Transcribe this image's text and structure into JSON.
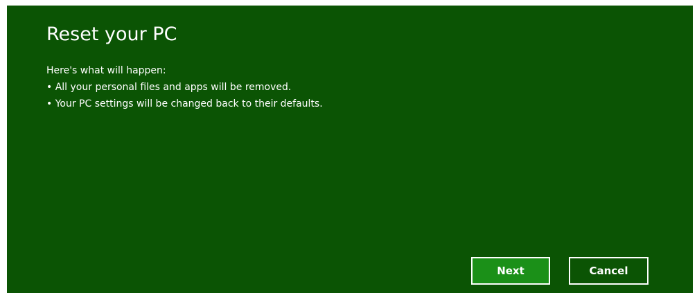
{
  "dialog": {
    "title": "Reset your PC",
    "intro": "Here's what will happen:",
    "bullets": [
      "• All your personal files and apps will be removed.",
      "• Your PC settings will be changed back to their defaults."
    ]
  },
  "buttons": {
    "next_label": "Next",
    "cancel_label": "Cancel"
  },
  "colors": {
    "background": "#0b5404",
    "accent_button": "#1b9018",
    "text": "#ffffff"
  }
}
